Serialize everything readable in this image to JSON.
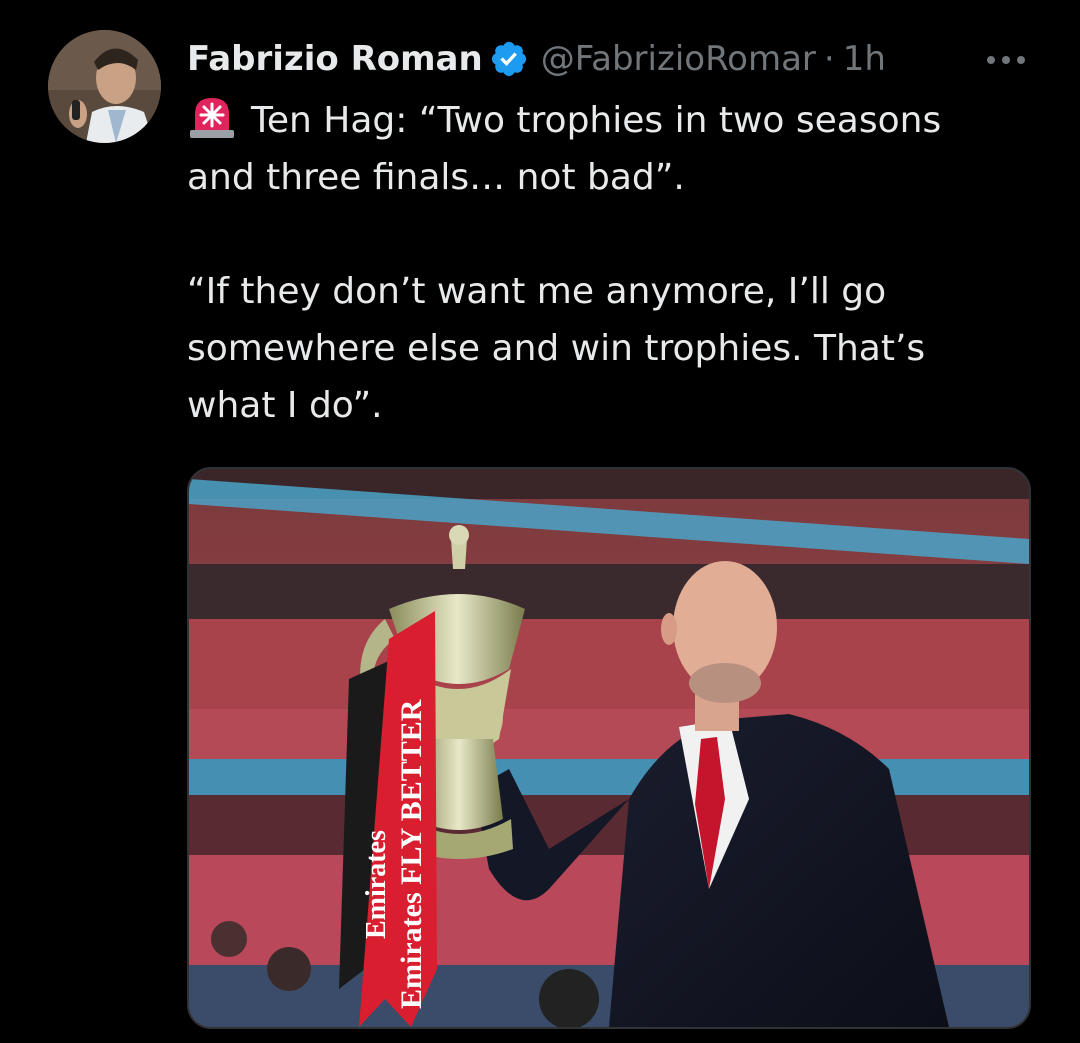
{
  "tweet": {
    "author_name": "Fabrizio Roman",
    "handle": "@FabrizioRomar",
    "separator": "·",
    "time": "1h",
    "line1": "Ten Hag: “Two trophies in two seasons",
    "line2": "and three finals… not bad”.",
    "line3": "“If they don’t want me anymore, I’ll go",
    "line4": "somewhere else and win trophies. That’s",
    "line5": "what I do”."
  },
  "media": {
    "ribbon_text_1": "Emirates FLY BETTER",
    "ribbon_text_2": "Emirates"
  },
  "colors": {
    "background": "#000000",
    "text": "#e7e9ea",
    "secondary": "#71767b",
    "verified_blue": "#1d9bf0",
    "siren_red": "#e0245e"
  },
  "icons": {
    "verified": "verified-badge-icon",
    "more": "more-icon",
    "siren": "siren-emoji-icon"
  }
}
